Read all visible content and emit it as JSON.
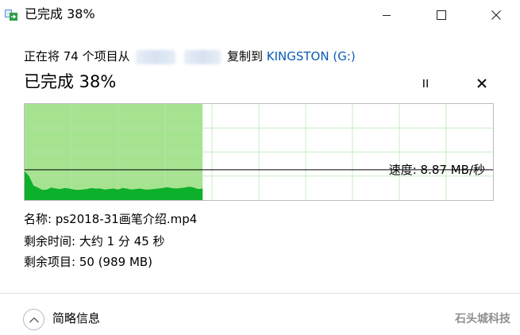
{
  "window": {
    "title": "已完成 38%",
    "minimize_icon": "minimize-icon",
    "maximize_icon": "maximize-icon",
    "close_icon": "close-icon"
  },
  "copy": {
    "prefix": "正在将 74 个项目从",
    "source_redacted": true,
    "middle": "复制到",
    "destination": "KINGSTON (G:)",
    "destination_color": "#0a5bb5"
  },
  "progress": {
    "heading": "已完成 38%",
    "percent": 38,
    "fill_color": "#a6e391",
    "speed_color": "#0db02b"
  },
  "speed": {
    "label": "速度: 8.87 MB/秒",
    "history_fraction": [
      0.6,
      0.5,
      0.3,
      0.26,
      0.21,
      0.22,
      0.26,
      0.24,
      0.23,
      0.25,
      0.24,
      0.22,
      0.21,
      0.22,
      0.23,
      0.25,
      0.24,
      0.24,
      0.22,
      0.23,
      0.24,
      0.22,
      0.25,
      0.24,
      0.22,
      0.23,
      0.24,
      0.22,
      0.22,
      0.23,
      0.24,
      0.25,
      0.27,
      0.25,
      0.24,
      0.25,
      0.26,
      0.28,
      0.26,
      0.23,
      0.24
    ],
    "current_fraction": 0.2
  },
  "details": {
    "name_label": "名称:",
    "name_value": "ps2018-31画笔介绍.mp4",
    "time_label": "剩余时间:",
    "time_value": "大约 1 分 45 秒",
    "items_label": "剩余项目:",
    "items_value": "50 (989 MB)"
  },
  "footer": {
    "toggle_label": "简略信息",
    "toggle_icon": "chevron-up-icon",
    "watermark": "石头城科技"
  }
}
